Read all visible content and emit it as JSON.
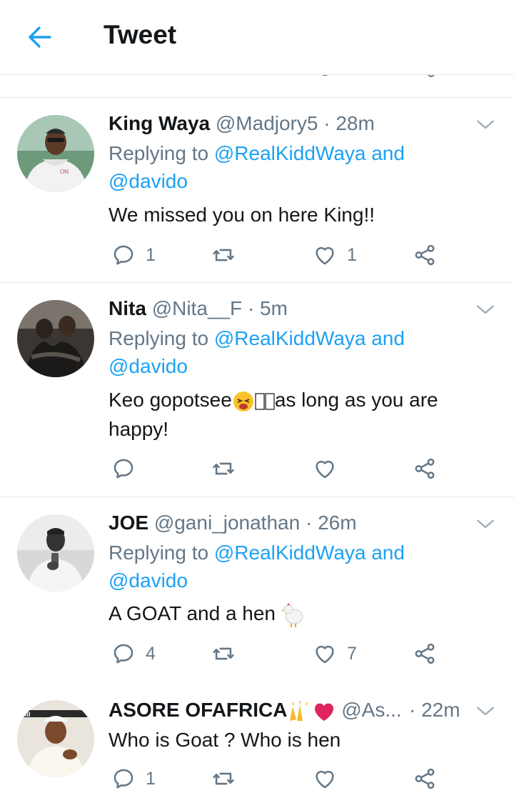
{
  "header": {
    "title": "Tweet"
  },
  "tweets": [
    {
      "name": "King Waya",
      "handle": "@Madjory5",
      "time": "· 28m",
      "reply_prefix": "Replying to ",
      "reply_to_1": "@RealKiddWaya and",
      "reply_to_2": "@davido",
      "text": "We missed you on here King!!",
      "reply_count": "1",
      "like_count": "1",
      "avatar_colors": {
        "bg": "#5a8a6a",
        "shirt": "#f3f3f3"
      }
    },
    {
      "name": "Nita",
      "handle": "@Nita__F",
      "time": "· 5m",
      "reply_prefix": "Replying to ",
      "reply_to_1": "@RealKiddWaya and",
      "reply_to_2": "@davido",
      "text_1": "Keo gopotsee",
      "text_2": "as long as you are",
      "text_3": "happy!",
      "reply_count": "",
      "like_count": ""
    },
    {
      "name": "JOE",
      "handle": "@gani_jonathan",
      "time": "· 26m",
      "reply_prefix": "Replying to ",
      "reply_to_1": "@RealKiddWaya and",
      "reply_to_2": "@davido",
      "text": "A GOAT and a hen",
      "reply_count": "4",
      "like_count": "7"
    },
    {
      "name": "ASORE OFAFRICA",
      "handle": "@As...",
      "time": "· 22m",
      "text": "Who is Goat ? Who is hen",
      "reply_count": "1",
      "like_count": ""
    }
  ],
  "icons": {
    "back": "back-arrow-icon",
    "chevron": "chevron-down-icon",
    "reply": "reply-icon",
    "retweet": "retweet-icon",
    "like": "heart-icon",
    "share": "share-icon"
  },
  "colors": {
    "accent": "#1da1f2",
    "secondary": "#657786",
    "divider": "#e1e8ed",
    "text": "#14171a"
  }
}
